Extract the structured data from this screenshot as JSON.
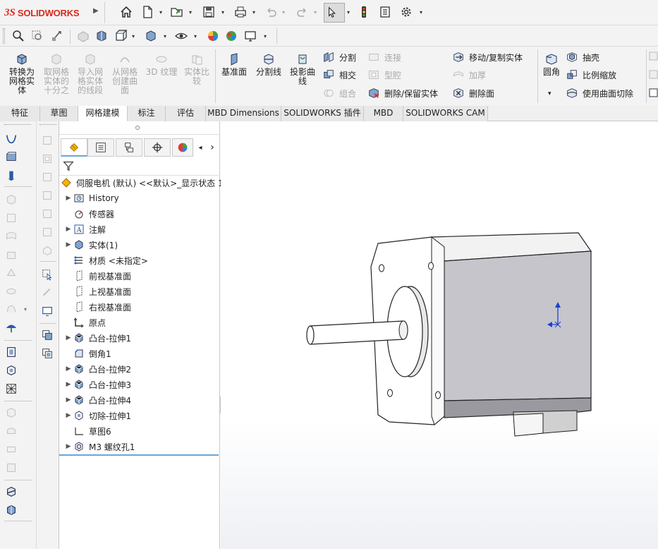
{
  "app": {
    "name": "SOLIDWORKS",
    "logo_prefix": "3S"
  },
  "quick_toolbar": {
    "icons": [
      "home-icon",
      "new-document-icon",
      "open-icon",
      "save-icon",
      "print-icon",
      "undo-icon",
      "redo-icon",
      "select-cursor-icon",
      "traffic-light-icon",
      "file-properties-icon",
      "options-gear-icon"
    ]
  },
  "ribbon": {
    "mesh_group": [
      {
        "label": "转换为\n网格实\n体",
        "enabled": true
      },
      {
        "label": "取网格\n实体的\n十分之",
        "enabled": false
      },
      {
        "label": "导入网\n格实体\n的线段",
        "enabled": false
      },
      {
        "label": "从网格\n创建曲\n面",
        "enabled": false
      },
      {
        "label": "3D 纹理",
        "enabled": false
      },
      {
        "label": "实体比\n较",
        "enabled": false
      }
    ],
    "ref_group": [
      {
        "label": "基准面",
        "enabled": true
      },
      {
        "label": "分割线",
        "enabled": true
      },
      {
        "label": "投影曲\n线",
        "enabled": true
      }
    ],
    "col1": [
      {
        "label": "分割",
        "enabled": true
      },
      {
        "label": "相交",
        "enabled": true
      },
      {
        "label": "组合",
        "enabled": false
      }
    ],
    "col2": [
      {
        "label": "连接",
        "enabled": false
      },
      {
        "label": "型腔",
        "enabled": false
      },
      {
        "label": "删除/保留实体",
        "enabled": true
      }
    ],
    "col3": [
      {
        "label": "移动/复制实体",
        "enabled": true
      },
      {
        "label": "加厚",
        "enabled": false
      },
      {
        "label": "删除面",
        "enabled": true
      }
    ],
    "fillet": {
      "label": "圆角"
    },
    "col4": [
      {
        "label": "抽壳",
        "enabled": true
      },
      {
        "label": "比例缩放",
        "enabled": true
      },
      {
        "label": "使用曲面切除",
        "enabled": true
      }
    ]
  },
  "tabs": [
    {
      "label": "特征"
    },
    {
      "label": "草图"
    },
    {
      "label": "网格建模",
      "active": true
    },
    {
      "label": "标注"
    },
    {
      "label": "评估"
    },
    {
      "label": "MBD Dimensions"
    },
    {
      "label": "SOLIDWORKS 插件"
    },
    {
      "label": "MBD"
    },
    {
      "label": "SOLIDWORKS CAM"
    }
  ],
  "feature_tree": {
    "root": "伺服电机 (默认) <<默认>_显示状态 1",
    "items": [
      {
        "label": "History",
        "expand": true,
        "icon": "history-icon"
      },
      {
        "label": "传感器",
        "expand": false,
        "icon": "sensor-icon"
      },
      {
        "label": "注解",
        "expand": true,
        "icon": "annotation-icon"
      },
      {
        "label": "实体(1)",
        "expand": true,
        "icon": "solid-body-icon"
      },
      {
        "label": "材质 <未指定>",
        "expand": false,
        "icon": "material-icon"
      },
      {
        "label": "前视基准面",
        "expand": false,
        "icon": "plane-icon"
      },
      {
        "label": "上视基准面",
        "expand": false,
        "icon": "plane-icon"
      },
      {
        "label": "右视基准面",
        "expand": false,
        "icon": "plane-icon"
      },
      {
        "label": "原点",
        "expand": false,
        "icon": "origin-icon"
      },
      {
        "label": "凸台-拉伸1",
        "expand": true,
        "icon": "boss-extrude-icon"
      },
      {
        "label": "倒角1",
        "expand": false,
        "icon": "chamfer-icon"
      },
      {
        "label": "凸台-拉伸2",
        "expand": true,
        "icon": "boss-extrude-icon"
      },
      {
        "label": "凸台-拉伸3",
        "expand": true,
        "icon": "boss-extrude-icon"
      },
      {
        "label": "凸台-拉伸4",
        "expand": true,
        "icon": "boss-extrude-icon"
      },
      {
        "label": "切除-拉伸1",
        "expand": true,
        "icon": "cut-extrude-icon"
      },
      {
        "label": "草图6",
        "expand": false,
        "icon": "sketch-icon"
      },
      {
        "label": "M3 螺纹孔1",
        "expand": true,
        "icon": "hole-wizard-icon"
      }
    ]
  }
}
